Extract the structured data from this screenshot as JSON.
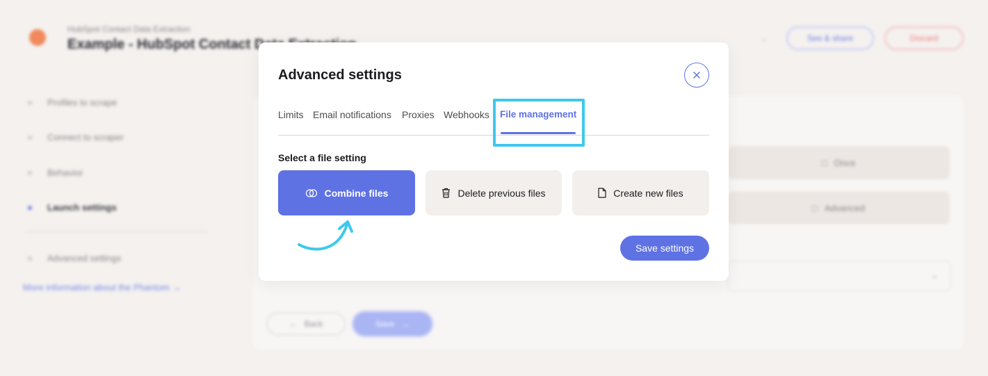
{
  "background": {
    "breadcrumb": "HubSpot Contact Data Extraction",
    "title": "Example - HubSpot Contact Data Extraction",
    "top_buttons": {
      "secondary": "See & share",
      "danger": "Discard"
    },
    "sidebar": {
      "items": [
        {
          "label": "Profiles to scrape"
        },
        {
          "label": "Connect to scraper"
        },
        {
          "label": "Behavior"
        },
        {
          "label": "Launch settings"
        }
      ],
      "advanced": "Advanced settings",
      "info_link": "More information about the Phantom →"
    },
    "panel": {
      "card_1": "Once",
      "card_2": "Advanced",
      "back_label": "Back",
      "next_label": "Save"
    }
  },
  "modal": {
    "title": "Advanced settings",
    "tabs": [
      {
        "label": "Limits"
      },
      {
        "label": "Email notifications"
      },
      {
        "label": "Proxies"
      },
      {
        "label": "Webhooks"
      },
      {
        "label": "File management"
      }
    ],
    "active_tab": "File management",
    "section_label": "Select a file setting",
    "options": [
      {
        "label": "Combine files",
        "icon": "combine-icon",
        "selected": true
      },
      {
        "label": "Delete previous files",
        "icon": "trash-icon",
        "selected": false
      },
      {
        "label": "Create new files",
        "icon": "file-icon",
        "selected": false
      }
    ],
    "save_label": "Save settings"
  },
  "colors": {
    "accent": "#5e72e4",
    "highlight": "#3ec8ee",
    "option_bg": "#f3efec"
  }
}
